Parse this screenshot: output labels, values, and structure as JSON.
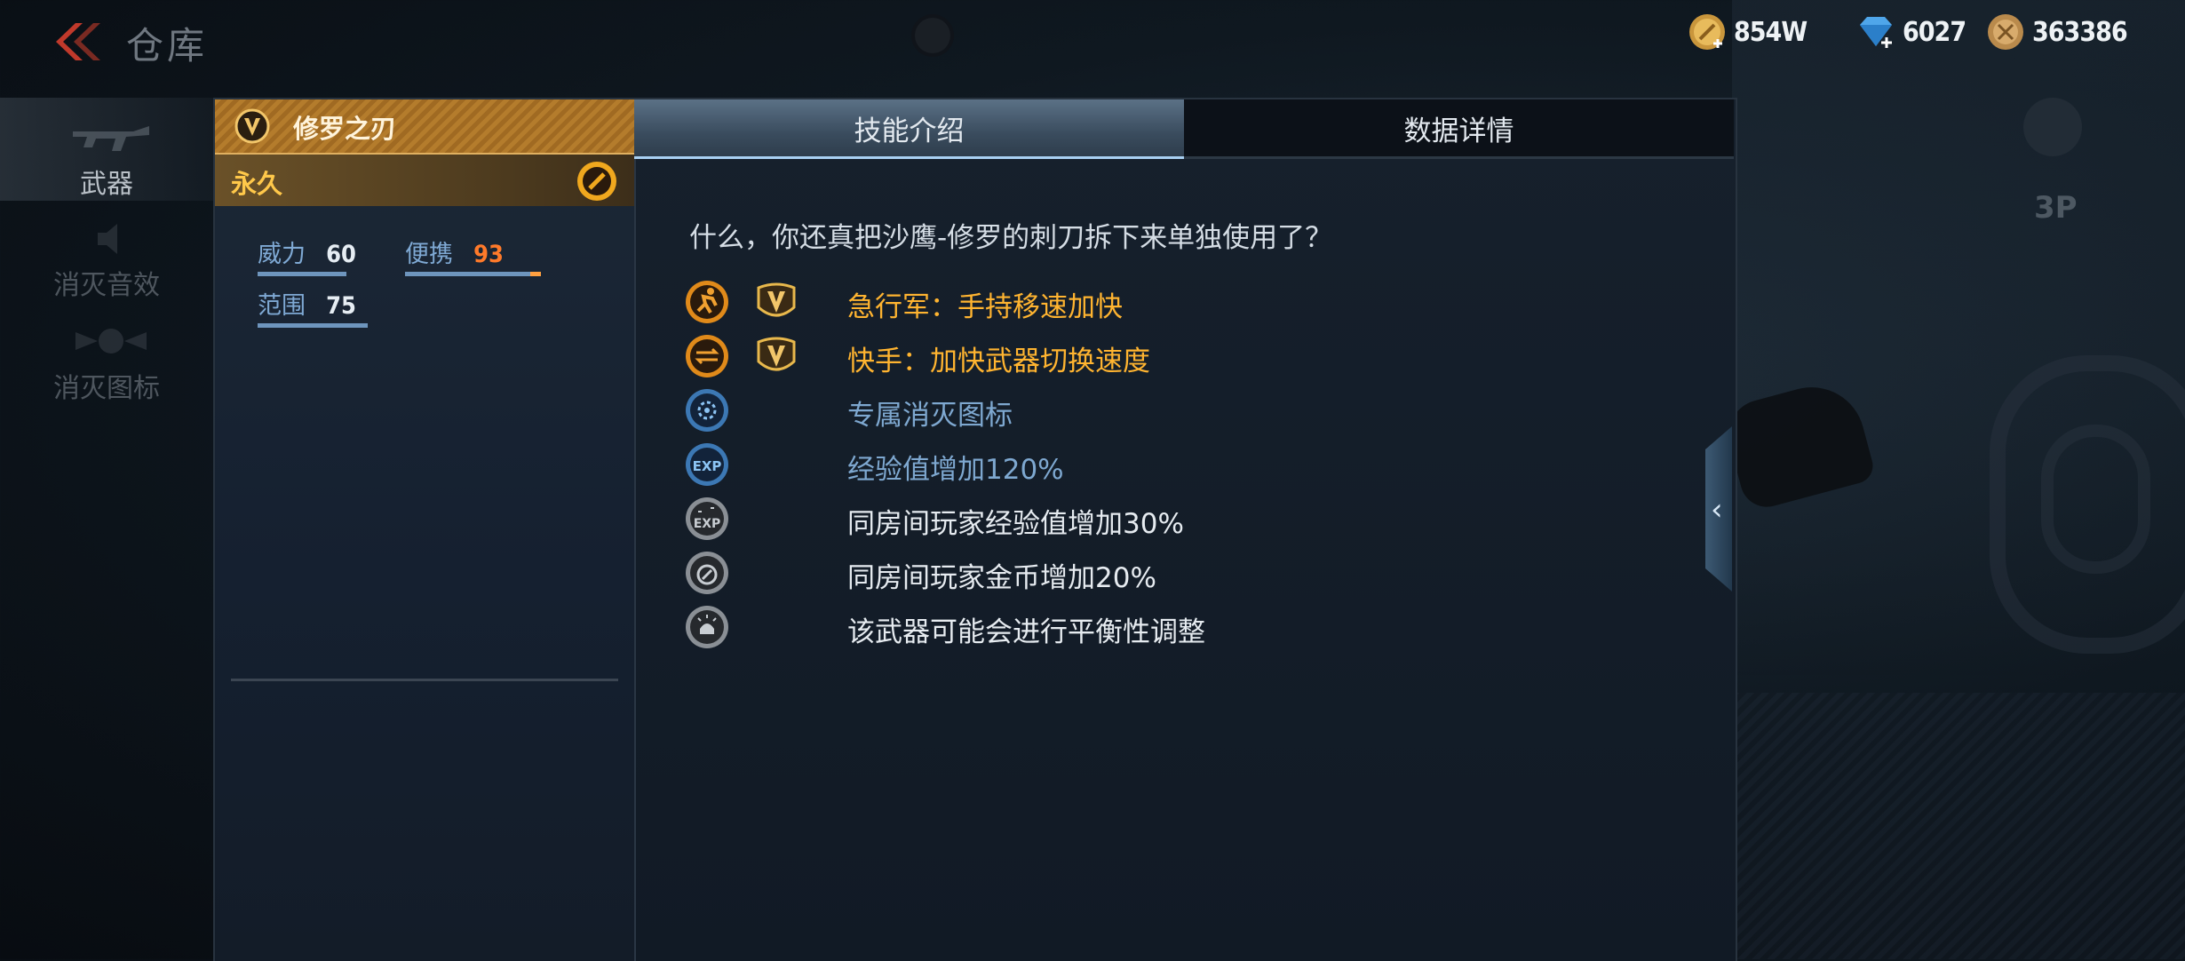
{
  "header": {
    "title": "仓库",
    "currencies": [
      {
        "name": "gold",
        "value": "854W"
      },
      {
        "name": "diamond",
        "value": "6027"
      },
      {
        "name": "coin",
        "value": "363386"
      }
    ],
    "view_mode": "3P"
  },
  "nav": {
    "items": [
      {
        "label": "武器",
        "active": true
      },
      {
        "label": "消灭音效",
        "active": false
      },
      {
        "label": "消灭图标",
        "active": false
      }
    ]
  },
  "weapon": {
    "name": "修罗之刃",
    "duration": "永久",
    "stats": {
      "power": {
        "label": "威力",
        "value": "60"
      },
      "portability": {
        "label": "便携",
        "value": "93"
      },
      "range": {
        "label": "范围",
        "value": "75"
      }
    }
  },
  "tabs": [
    {
      "label": "技能介绍",
      "active": true
    },
    {
      "label": "数据详情",
      "active": false
    }
  ],
  "content": {
    "description": "什么，你还真把沙鹰-修罗的刺刀拆下来单独使用了？",
    "skills": [
      {
        "icon": "run-icon",
        "vip": true,
        "text": "急行军：手持移速加快",
        "color": "#ffb430"
      },
      {
        "icon": "swap-icon",
        "vip": true,
        "text": "快手：加快武器切换速度",
        "color": "#ffb430"
      },
      {
        "icon": "kill-icon",
        "vip": false,
        "text": "专属消灭图标",
        "color": "#7ea8d0"
      },
      {
        "icon": "exp-icon",
        "vip": false,
        "text": "经验值增加120%",
        "color": "#7ea8d0"
      },
      {
        "icon": "room-exp-icon",
        "vip": false,
        "text": "同房间玩家经验值增加30%",
        "color": "#e6ebf0"
      },
      {
        "icon": "room-gold-icon",
        "vip": false,
        "text": "同房间玩家金币增加20%",
        "color": "#e6ebf0"
      },
      {
        "icon": "balance-icon",
        "vip": false,
        "text": "该武器可能会进行平衡性调整",
        "color": "#e6ebf0"
      }
    ]
  },
  "colors": {
    "gold_text": "#ffb430",
    "blue_text": "#7ea8d0",
    "accent_tab": "#a9d0f2"
  }
}
